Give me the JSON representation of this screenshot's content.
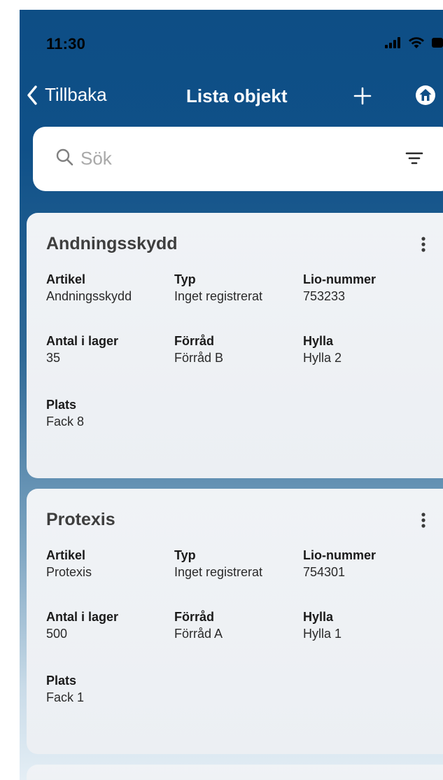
{
  "status_bar": {
    "time": "11:30"
  },
  "nav": {
    "back_label": "Tillbaka",
    "title": "Lista objekt",
    "add_label": "+"
  },
  "search": {
    "placeholder": "Sök"
  },
  "items": [
    {
      "title": "Andningsskydd",
      "fields": [
        {
          "label": "Artikel",
          "value": "Andningsskydd"
        },
        {
          "label": "Typ",
          "value": "Inget registrerat"
        },
        {
          "label": "Lio-nummer",
          "value": "753233"
        },
        {
          "label": "Antal i lager",
          "value": "35"
        },
        {
          "label": "Förråd",
          "value": "Förråd B"
        },
        {
          "label": "Hylla",
          "value": "Hylla 2"
        },
        {
          "label": "Plats",
          "value": "Fack 8"
        }
      ]
    },
    {
      "title": "Protexis",
      "fields": [
        {
          "label": "Artikel",
          "value": "Protexis"
        },
        {
          "label": "Typ",
          "value": "Inget registrerat"
        },
        {
          "label": "Lio-nummer",
          "value": "754301"
        },
        {
          "label": "Antal i lager",
          "value": "500"
        },
        {
          "label": "Förråd",
          "value": "Förråd A"
        },
        {
          "label": "Hylla",
          "value": "Hylla 1"
        },
        {
          "label": "Plats",
          "value": "Fack 1"
        }
      ]
    }
  ],
  "icons": {
    "back": "chevron-left-icon",
    "add": "plus-icon",
    "home": "home-icon",
    "search": "search-icon",
    "filter": "filter-icon",
    "menu": "more-vertical-icon",
    "signal": "cellular-signal-icon",
    "wifi": "wifi-icon",
    "battery": "battery-icon"
  },
  "colors": {
    "header_blue": "#0e4e85",
    "card_background": "#eceff3",
    "white": "#ffffff"
  }
}
